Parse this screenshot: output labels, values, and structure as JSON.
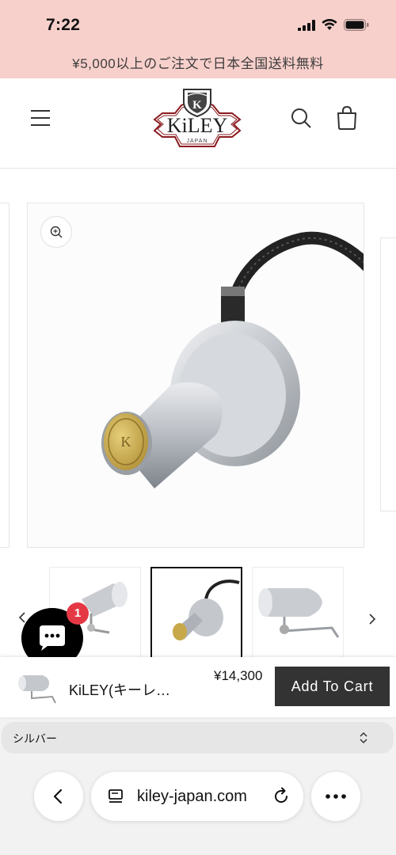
{
  "status_bar": {
    "time": "7:22",
    "icons": [
      "signal-icon",
      "wifi-icon",
      "battery-icon"
    ]
  },
  "announcement": {
    "text": "¥5,000以上のご注文で日本全国送料無料"
  },
  "header": {
    "logo_text": "KiLEY",
    "logo_sub": "JAPAN",
    "logo_letter": "K",
    "icons": [
      "menu-icon",
      "search-icon",
      "cart-icon"
    ]
  },
  "gallery": {
    "zoom_icon": "zoom-in-icon",
    "selected_thumbnail": 2,
    "thumbnail_count": 3
  },
  "chat": {
    "badge_count": "1"
  },
  "sticky_bar": {
    "title": "KiLEY(キーレ…",
    "price": "¥14,300",
    "add_to_cart": "Add To Cart",
    "variant_selected": "シルバー"
  },
  "browser": {
    "url": "kiley-japan.com",
    "icons": [
      "back-icon",
      "page-icon",
      "reload-icon",
      "more-icon"
    ]
  },
  "colors": {
    "announcement_bg": "#f8d0cb",
    "logo_red": "#8b1a1f",
    "button_dark": "#333333",
    "badge_red": "#e53845"
  }
}
